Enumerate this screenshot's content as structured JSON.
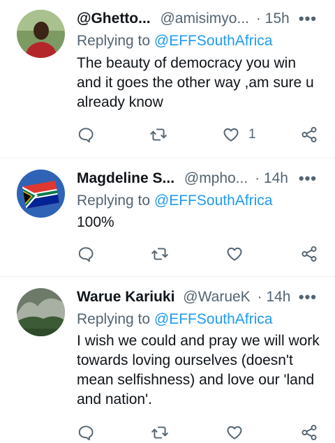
{
  "tweets": [
    {
      "display_name": "@Ghetto...",
      "handle": "@amisimyo...",
      "separator": "·",
      "time": "15h",
      "more_icon": "more-dots-icon",
      "replying_prefix": "Replying to",
      "replying_handle": "@EFFSouthAfrica",
      "text": "The beauty of democracy you win and it goes the other way ,am sure u already know",
      "likes": "1"
    },
    {
      "display_name": "Magdeline S...",
      "handle": "@mpho...",
      "separator": "·",
      "time": "14h",
      "more_icon": "more-dots-icon",
      "replying_prefix": "Replying to",
      "replying_handle": "@EFFSouthAfrica",
      "text": "100%",
      "likes": ""
    },
    {
      "display_name": "Warue Kariuki",
      "handle": "@WarueK",
      "separator": "·",
      "time": "14h",
      "more_icon": "more-dots-icon",
      "replying_prefix": "Replying to",
      "replying_handle": "@EFFSouthAfrica",
      "text": "I wish we could and pray we will work towards loving ourselves (doesn't mean selfishness) and love our 'land and nation'.",
      "likes": ""
    }
  ],
  "icons": {
    "reply": "reply-icon",
    "retweet": "retweet-icon",
    "like": "like-icon",
    "share": "share-icon"
  },
  "colors": {
    "link": "#1d9bf0",
    "secondary": "#536471",
    "text": "#0f1419"
  }
}
